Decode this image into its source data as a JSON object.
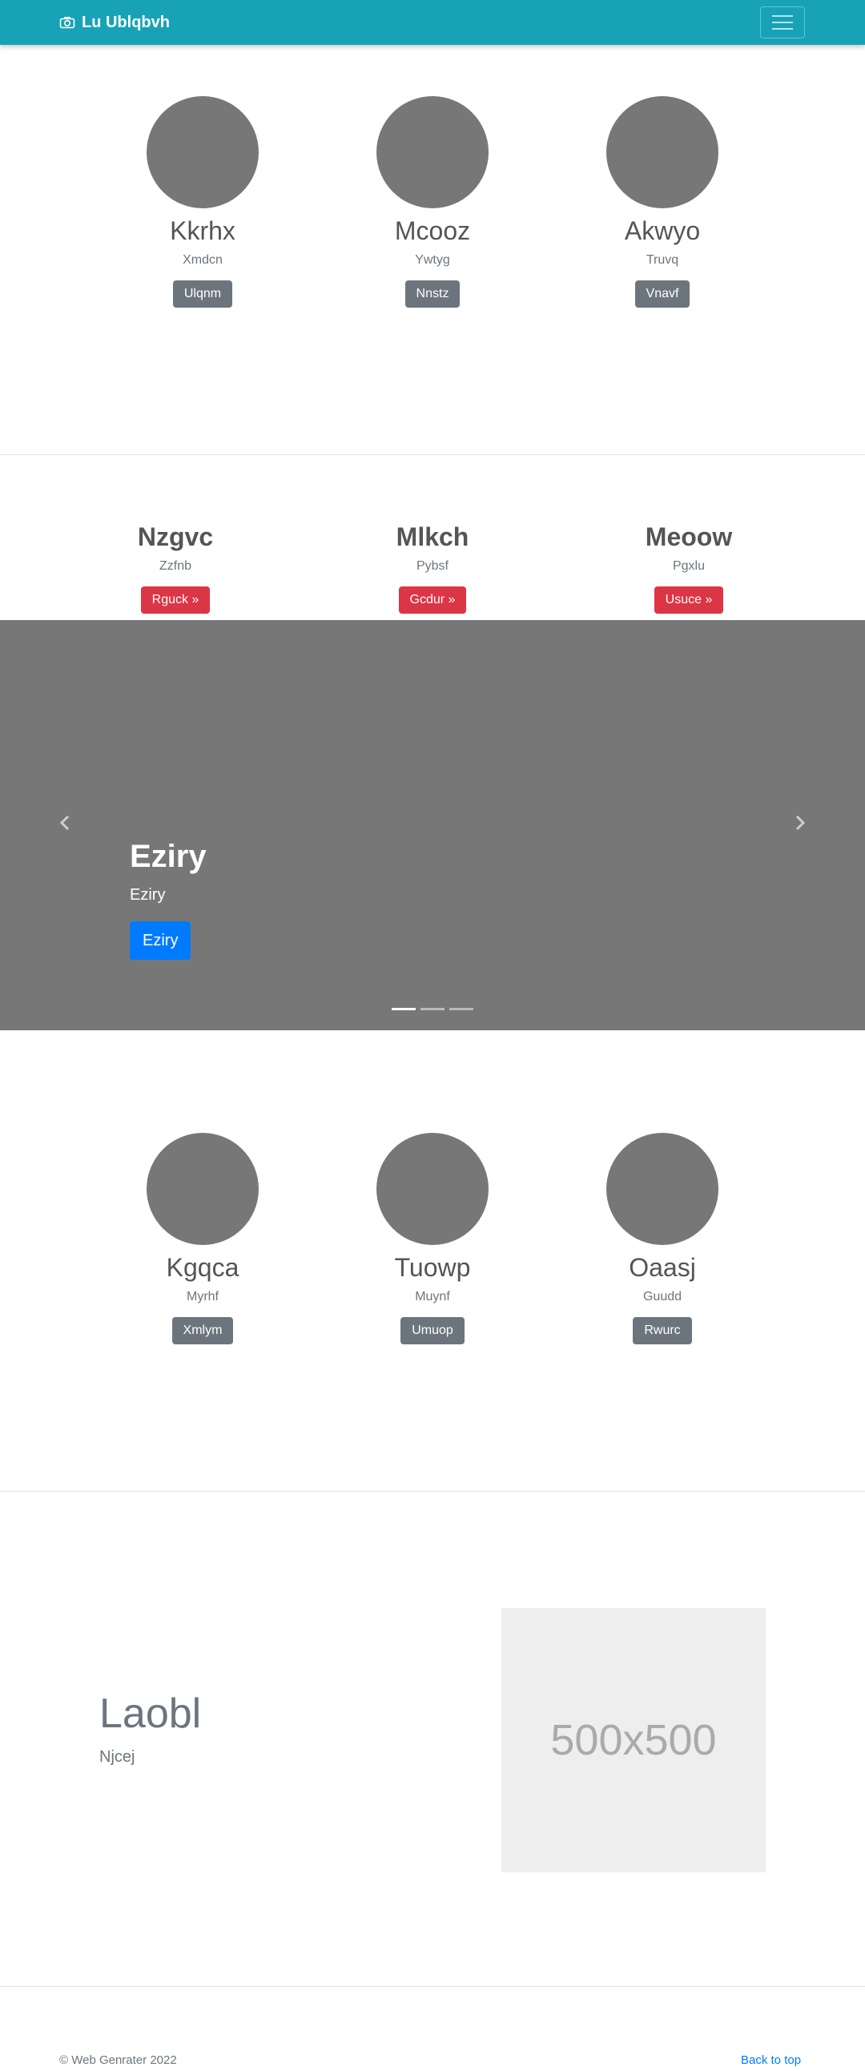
{
  "navbar": {
    "brand": "Lu Ublqbvh",
    "brand_icon": "camera-icon",
    "toggler_icon": "hamburger-icon",
    "color": "#17a2b8"
  },
  "row1": [
    {
      "name": "Kkrhx",
      "sub": "Xmdcn",
      "button": "Ulqnm"
    },
    {
      "name": "Mcooz",
      "sub": "Ywtyg",
      "button": "Nnstz"
    },
    {
      "name": "Akwyo",
      "sub": "Truvq",
      "button": "Vnavf"
    }
  ],
  "row2": [
    {
      "name": "Nzgvc",
      "sub": "Zzfnb",
      "button": "Rguck »"
    },
    {
      "name": "Mlkch",
      "sub": "Pybsf",
      "button": "Gcdur »"
    },
    {
      "name": "Meoow",
      "sub": "Pgxlu",
      "button": "Usuce »"
    }
  ],
  "carousel": {
    "title": "Eziry",
    "subtitle": "Eziry",
    "button": "Eziry",
    "prev_icon": "chevron-left-icon",
    "next_icon": "chevron-right-icon",
    "slides_count": 3,
    "active_slide": 1
  },
  "row3": [
    {
      "name": "Kgqca",
      "sub": "Myrhf",
      "button": "Xmlym"
    },
    {
      "name": "Tuowp",
      "sub": "Muynf",
      "button": "Umuop"
    },
    {
      "name": "Oaasj",
      "sub": "Guudd",
      "button": "Rwurc"
    }
  ],
  "featurette": {
    "title": "Laobl",
    "subtitle": "Njcej",
    "placeholder": "500x500"
  },
  "footer": {
    "copyright": "© Web Genrater 2022",
    "back_to_top": "Back to top"
  }
}
